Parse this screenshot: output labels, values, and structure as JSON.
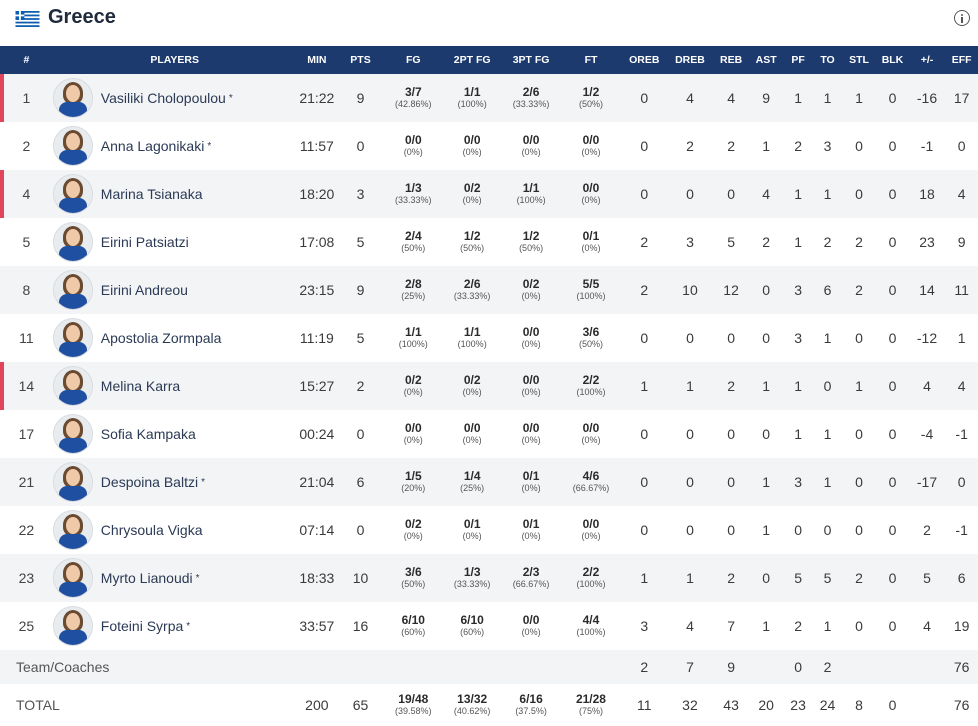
{
  "header": {
    "team_name": "Greece",
    "flag_icon": "greece-flag-icon",
    "info_icon": "info-icon"
  },
  "colors": {
    "header_bg": "#1c3a6e",
    "starter_marker": "#e0455b"
  },
  "columns": [
    "#",
    "PLAYERS",
    "MIN",
    "PTS",
    "FG",
    "2PT FG",
    "3PT FG",
    "FT",
    "OREB",
    "DREB",
    "REB",
    "AST",
    "PF",
    "TO",
    "STL",
    "BLK",
    "+/-",
    "EFF"
  ],
  "players": [
    {
      "num": "1",
      "name": "Vasiliki Cholopoulou",
      "star": "*",
      "marked": true,
      "min": "21:22",
      "pts": "9",
      "fg": "3/7",
      "fg_pct": "(42.86%)",
      "fg2": "1/1",
      "fg2_pct": "(100%)",
      "fg3": "2/6",
      "fg3_pct": "(33.33%)",
      "ft": "1/2",
      "ft_pct": "(50%)",
      "oreb": "0",
      "dreb": "4",
      "reb": "4",
      "ast": "9",
      "pf": "1",
      "to": "1",
      "stl": "1",
      "blk": "0",
      "pm": "-16",
      "eff": "17"
    },
    {
      "num": "2",
      "name": "Anna Lagonikaki",
      "star": "*",
      "marked": false,
      "min": "11:57",
      "pts": "0",
      "fg": "0/0",
      "fg_pct": "(0%)",
      "fg2": "0/0",
      "fg2_pct": "(0%)",
      "fg3": "0/0",
      "fg3_pct": "(0%)",
      "ft": "0/0",
      "ft_pct": "(0%)",
      "oreb": "0",
      "dreb": "2",
      "reb": "2",
      "ast": "1",
      "pf": "2",
      "to": "3",
      "stl": "0",
      "blk": "0",
      "pm": "-1",
      "eff": "0"
    },
    {
      "num": "4",
      "name": "Marina Tsianaka",
      "star": "",
      "marked": true,
      "min": "18:20",
      "pts": "3",
      "fg": "1/3",
      "fg_pct": "(33.33%)",
      "fg2": "0/2",
      "fg2_pct": "(0%)",
      "fg3": "1/1",
      "fg3_pct": "(100%)",
      "ft": "0/0",
      "ft_pct": "(0%)",
      "oreb": "0",
      "dreb": "0",
      "reb": "0",
      "ast": "4",
      "pf": "1",
      "to": "1",
      "stl": "0",
      "blk": "0",
      "pm": "18",
      "eff": "4"
    },
    {
      "num": "5",
      "name": "Eirini Patsiatzi",
      "star": "",
      "marked": false,
      "min": "17:08",
      "pts": "5",
      "fg": "2/4",
      "fg_pct": "(50%)",
      "fg2": "1/2",
      "fg2_pct": "(50%)",
      "fg3": "1/2",
      "fg3_pct": "(50%)",
      "ft": "0/1",
      "ft_pct": "(0%)",
      "oreb": "2",
      "dreb": "3",
      "reb": "5",
      "ast": "2",
      "pf": "1",
      "to": "2",
      "stl": "2",
      "blk": "0",
      "pm": "23",
      "eff": "9"
    },
    {
      "num": "8",
      "name": "Eirini Andreou",
      "star": "",
      "marked": false,
      "min": "23:15",
      "pts": "9",
      "fg": "2/8",
      "fg_pct": "(25%)",
      "fg2": "2/6",
      "fg2_pct": "(33.33%)",
      "fg3": "0/2",
      "fg3_pct": "(0%)",
      "ft": "5/5",
      "ft_pct": "(100%)",
      "oreb": "2",
      "dreb": "10",
      "reb": "12",
      "ast": "0",
      "pf": "3",
      "to": "6",
      "stl": "2",
      "blk": "0",
      "pm": "14",
      "eff": "11"
    },
    {
      "num": "11",
      "name": "Apostolia Zormpala",
      "star": "",
      "marked": false,
      "min": "11:19",
      "pts": "5",
      "fg": "1/1",
      "fg_pct": "(100%)",
      "fg2": "1/1",
      "fg2_pct": "(100%)",
      "fg3": "0/0",
      "fg3_pct": "(0%)",
      "ft": "3/6",
      "ft_pct": "(50%)",
      "oreb": "0",
      "dreb": "0",
      "reb": "0",
      "ast": "0",
      "pf": "3",
      "to": "1",
      "stl": "0",
      "blk": "0",
      "pm": "-12",
      "eff": "1"
    },
    {
      "num": "14",
      "name": "Melina Karra",
      "star": "",
      "marked": true,
      "min": "15:27",
      "pts": "2",
      "fg": "0/2",
      "fg_pct": "(0%)",
      "fg2": "0/2",
      "fg2_pct": "(0%)",
      "fg3": "0/0",
      "fg3_pct": "(0%)",
      "ft": "2/2",
      "ft_pct": "(100%)",
      "oreb": "1",
      "dreb": "1",
      "reb": "2",
      "ast": "1",
      "pf": "1",
      "to": "0",
      "stl": "1",
      "blk": "0",
      "pm": "4",
      "eff": "4"
    },
    {
      "num": "17",
      "name": "Sofia Kampaka",
      "star": "",
      "marked": false,
      "min": "00:24",
      "pts": "0",
      "fg": "0/0",
      "fg_pct": "(0%)",
      "fg2": "0/0",
      "fg2_pct": "(0%)",
      "fg3": "0/0",
      "fg3_pct": "(0%)",
      "ft": "0/0",
      "ft_pct": "(0%)",
      "oreb": "0",
      "dreb": "0",
      "reb": "0",
      "ast": "0",
      "pf": "1",
      "to": "1",
      "stl": "0",
      "blk": "0",
      "pm": "-4",
      "eff": "-1"
    },
    {
      "num": "21",
      "name": "Despoina Baltzi",
      "star": "*",
      "marked": false,
      "min": "21:04",
      "pts": "6",
      "fg": "1/5",
      "fg_pct": "(20%)",
      "fg2": "1/4",
      "fg2_pct": "(25%)",
      "fg3": "0/1",
      "fg3_pct": "(0%)",
      "ft": "4/6",
      "ft_pct": "(66.67%)",
      "oreb": "0",
      "dreb": "0",
      "reb": "0",
      "ast": "1",
      "pf": "3",
      "to": "1",
      "stl": "0",
      "blk": "0",
      "pm": "-17",
      "eff": "0"
    },
    {
      "num": "22",
      "name": "Chrysoula Vigka",
      "star": "",
      "marked": false,
      "min": "07:14",
      "pts": "0",
      "fg": "0/2",
      "fg_pct": "(0%)",
      "fg2": "0/1",
      "fg2_pct": "(0%)",
      "fg3": "0/1",
      "fg3_pct": "(0%)",
      "ft": "0/0",
      "ft_pct": "(0%)",
      "oreb": "0",
      "dreb": "0",
      "reb": "0",
      "ast": "1",
      "pf": "0",
      "to": "0",
      "stl": "0",
      "blk": "0",
      "pm": "2",
      "eff": "-1"
    },
    {
      "num": "23",
      "name": "Myrto Lianoudi",
      "star": "*",
      "marked": false,
      "min": "18:33",
      "pts": "10",
      "fg": "3/6",
      "fg_pct": "(50%)",
      "fg2": "1/3",
      "fg2_pct": "(33.33%)",
      "fg3": "2/3",
      "fg3_pct": "(66.67%)",
      "ft": "2/2",
      "ft_pct": "(100%)",
      "oreb": "1",
      "dreb": "1",
      "reb": "2",
      "ast": "0",
      "pf": "5",
      "to": "5",
      "stl": "2",
      "blk": "0",
      "pm": "5",
      "eff": "6"
    },
    {
      "num": "25",
      "name": "Foteini Syrpa",
      "star": "*",
      "marked": false,
      "min": "33:57",
      "pts": "16",
      "fg": "6/10",
      "fg_pct": "(60%)",
      "fg2": "6/10",
      "fg2_pct": "(60%)",
      "fg3": "0/0",
      "fg3_pct": "(0%)",
      "ft": "4/4",
      "ft_pct": "(100%)",
      "oreb": "3",
      "dreb": "4",
      "reb": "7",
      "ast": "1",
      "pf": "2",
      "to": "1",
      "stl": "0",
      "blk": "0",
      "pm": "4",
      "eff": "19"
    }
  ],
  "team_row": {
    "label": "Team/Coaches",
    "oreb": "2",
    "dreb": "7",
    "reb": "9",
    "pf": "0",
    "to": "2",
    "eff": "76"
  },
  "total_row": {
    "label": "TOTAL",
    "min": "200",
    "pts": "65",
    "fg": "19/48",
    "fg_pct": "(39.58%)",
    "fg2": "13/32",
    "fg2_pct": "(40.62%)",
    "fg3": "6/16",
    "fg3_pct": "(37.5%)",
    "ft": "21/28",
    "ft_pct": "(75%)",
    "oreb": "11",
    "dreb": "32",
    "reb": "43",
    "ast": "20",
    "pf": "23",
    "to": "24",
    "stl": "8",
    "blk": "0",
    "eff": "76"
  }
}
